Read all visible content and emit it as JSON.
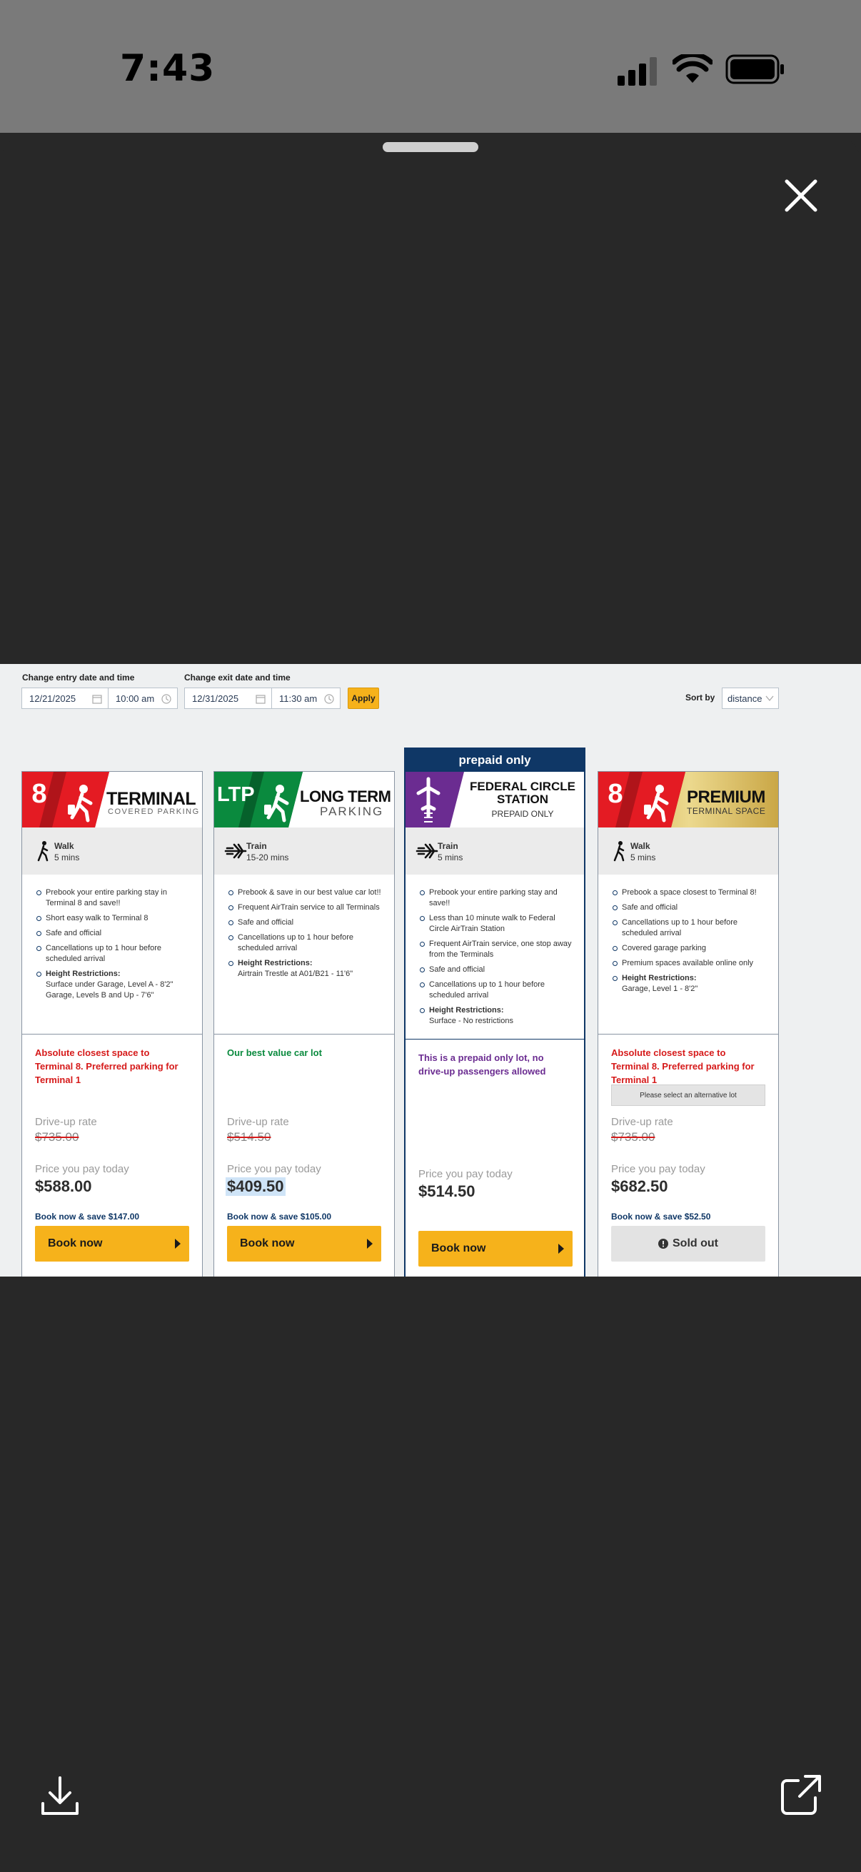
{
  "status_bar": {
    "time": "7:43"
  },
  "controls": {
    "entry_label": "Change entry date and time",
    "entry_date": "12/21/2025",
    "entry_time": "10:00 am",
    "exit_label": "Change exit date and time",
    "exit_date": "12/31/2025",
    "exit_time": "11:30 am",
    "apply": "Apply",
    "sort_label": "Sort by",
    "sort_value": "distance"
  },
  "cards": [
    {
      "logo_badge": "8",
      "logo_title": "TERMINAL",
      "logo_sub": "COVERED PARKING",
      "mode": "Walk",
      "time": "5 mins",
      "bullets": [
        "Prebook your entire parking stay in Terminal 8 and save!!",
        "Short easy walk to Terminal 8",
        "Safe and official",
        "Cancellations up to 1 hour before scheduled arrival"
      ],
      "height_label": "Height Restrictions:",
      "height_value": "Surface under Garage, Level A - 8'2\" Garage, Levels B and Up - 7'6\"",
      "promo": "Absolute closest space to Terminal 8. Preferred parking for Terminal 1",
      "drive_label": "Drive-up rate",
      "drive_rate": "$735.00",
      "pay_label": "Price you pay today",
      "pay_price": "$588.00",
      "save": "Book now & save $147.00",
      "book": "Book now"
    },
    {
      "logo_badge": "LTP",
      "logo_title": "LONG TERM",
      "logo_sub": "PARKING",
      "mode": "Train",
      "time": "15-20 mins",
      "bullets": [
        "Prebook & save in our best value car lot!!",
        "Frequent AirTrain service to all Terminals",
        "Safe and official",
        "Cancellations up to 1 hour before scheduled arrival"
      ],
      "height_label": "Height Restrictions:",
      "height_value": "Airtrain Trestle at A01/B21 - 11'6\"",
      "promo": "Our best value car lot",
      "drive_label": "Drive-up rate",
      "drive_rate": "$514.50",
      "pay_label": "Price you pay today",
      "pay_price": "$409.50",
      "save": "Book now & save $105.00",
      "book": "Book now"
    },
    {
      "banner": "prepaid only",
      "logo_title": "FEDERAL CIRCLE STATION",
      "logo_sub": "PREPAID ONLY",
      "mode": "Train",
      "time": "5 mins",
      "bullets": [
        "Prebook your entire parking stay and save!!",
        "Less than 10 minute walk to Federal Circle AirTrain Station",
        "Frequent AirTrain service, one stop away from the Terminals",
        "Safe and official",
        "Cancellations up to 1 hour before scheduled arrival"
      ],
      "height_label": "Height Restrictions:",
      "height_value": "Surface - No restrictions",
      "promo": "This is a prepaid only lot, no drive-up passengers allowed",
      "pay_label": "Price you pay today",
      "pay_price": "$514.50",
      "book": "Book now"
    },
    {
      "logo_badge": "8",
      "logo_title": "PREMIUM",
      "logo_sub": "TERMINAL SPACE",
      "mode": "Walk",
      "time": "5 mins",
      "bullets": [
        "Prebook a space closest to Terminal 8!",
        "Safe and official",
        "Cancellations up to 1 hour before scheduled arrival",
        "Covered garage parking",
        "Premium spaces available online only"
      ],
      "height_label": "Height Restrictions:",
      "height_value": "Garage, Level 1 - 8'2\"",
      "promo": "Absolute closest space to Terminal 8. Preferred parking for Terminal 1",
      "notice": "Please select an alternative lot",
      "drive_label": "Drive-up rate",
      "drive_rate": "$735.00",
      "pay_label": "Price you pay today",
      "pay_price": "$682.50",
      "save": "Book now & save $52.50",
      "sold_out": "Sold out"
    }
  ],
  "colors": {
    "red": "#d61a1a",
    "green": "#0a8a3e",
    "purple": "#6b2c91",
    "navy": "#0f3766",
    "yellow": "#f6b21b",
    "gold": "#d8bf66"
  },
  "icons": [
    "close-icon",
    "download-icon",
    "share-icon",
    "walk-icon",
    "plane-icon",
    "calendar-icon",
    "clock-icon"
  ]
}
